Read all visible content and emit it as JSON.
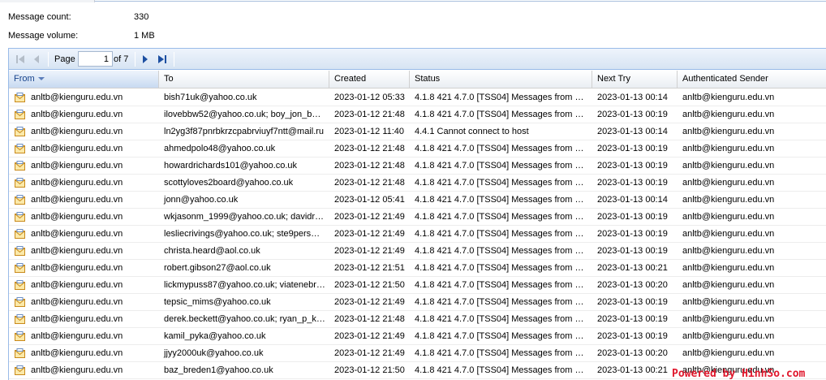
{
  "summary": {
    "message_count_label": "Message count:",
    "message_count_value": "330",
    "message_volume_label": "Message volume:",
    "message_volume_value": "1 MB"
  },
  "pager": {
    "page_label": "Page",
    "current_page": "1",
    "of_label": "of 7",
    "icons": [
      "first-page-icon",
      "previous-page-icon",
      "next-page-icon",
      "last-page-icon"
    ]
  },
  "columns": {
    "from": "From",
    "to": "To",
    "created": "Created",
    "status": "Status",
    "next_try": "Next Try",
    "auth_sender": "Authenticated Sender",
    "sorted_column": "from",
    "sort_direction": "descending"
  },
  "rows": [
    {
      "from": "anltb@kienguru.edu.vn",
      "to": "bish71uk@yahoo.co.uk",
      "created": "2023-01-12 05:33",
      "status": "4.1.8 421 4.7.0 [TSS04] Messages from …",
      "next_try": "2023-01-13 00:14",
      "auth": "anltb@kienguru.edu.vn"
    },
    {
      "from": "anltb@kienguru.edu.vn",
      "to": "ilovebbw52@yahoo.co.uk; boy_jon_b…",
      "created": "2023-01-12 21:48",
      "status": "4.1.8 421 4.7.0 [TSS04] Messages from …",
      "next_try": "2023-01-13 00:19",
      "auth": "anltb@kienguru.edu.vn"
    },
    {
      "from": "anltb@kienguru.edu.vn",
      "to": "ln2yg3f87pnrbkrzcpabrviuyf7ntt@mail.ru",
      "created": "2023-01-12 11:40",
      "status": "4.4.1 Cannot connect to host",
      "next_try": "2023-01-13 00:14",
      "auth": "anltb@kienguru.edu.vn"
    },
    {
      "from": "anltb@kienguru.edu.vn",
      "to": "ahmedpolo48@yahoo.co.uk",
      "created": "2023-01-12 21:48",
      "status": "4.1.8 421 4.7.0 [TSS04] Messages from …",
      "next_try": "2023-01-13 00:19",
      "auth": "anltb@kienguru.edu.vn"
    },
    {
      "from": "anltb@kienguru.edu.vn",
      "to": "howardrichards101@yahoo.co.uk",
      "created": "2023-01-12 21:48",
      "status": "4.1.8 421 4.7.0 [TSS04] Messages from …",
      "next_try": "2023-01-13 00:19",
      "auth": "anltb@kienguru.edu.vn"
    },
    {
      "from": "anltb@kienguru.edu.vn",
      "to": "scottyloves2board@yahoo.co.uk",
      "created": "2023-01-12 21:48",
      "status": "4.1.8 421 4.7.0 [TSS04] Messages from …",
      "next_try": "2023-01-13 00:19",
      "auth": "anltb@kienguru.edu.vn"
    },
    {
      "from": "anltb@kienguru.edu.vn",
      "to": "jonn@yahoo.co.uk",
      "created": "2023-01-12 05:41",
      "status": "4.1.8 421 4.7.0 [TSS04] Messages from …",
      "next_try": "2023-01-13 00:14",
      "auth": "anltb@kienguru.edu.vn"
    },
    {
      "from": "anltb@kienguru.edu.vn",
      "to": "wkjasonm_1999@yahoo.co.uk; davidr…",
      "created": "2023-01-12 21:49",
      "status": "4.1.8 421 4.7.0 [TSS04] Messages from …",
      "next_try": "2023-01-13 00:19",
      "auth": "anltb@kienguru.edu.vn"
    },
    {
      "from": "anltb@kienguru.edu.vn",
      "to": "lesliecrivings@yahoo.co.uk; ste9pers…",
      "created": "2023-01-12 21:49",
      "status": "4.1.8 421 4.7.0 [TSS04] Messages from …",
      "next_try": "2023-01-13 00:19",
      "auth": "anltb@kienguru.edu.vn"
    },
    {
      "from": "anltb@kienguru.edu.vn",
      "to": "christa.heard@aol.co.uk",
      "created": "2023-01-12 21:49",
      "status": "4.1.8 421 4.7.0 [TSS04] Messages from …",
      "next_try": "2023-01-13 00:19",
      "auth": "anltb@kienguru.edu.vn"
    },
    {
      "from": "anltb@kienguru.edu.vn",
      "to": "robert.gibson27@aol.co.uk",
      "created": "2023-01-12 21:51",
      "status": "4.1.8 421 4.7.0 [TSS04] Messages from …",
      "next_try": "2023-01-13 00:21",
      "auth": "anltb@kienguru.edu.vn"
    },
    {
      "from": "anltb@kienguru.edu.vn",
      "to": "lickmypuss87@yahoo.co.uk; viatenebr…",
      "created": "2023-01-12 21:50",
      "status": "4.1.8 421 4.7.0 [TSS04] Messages from …",
      "next_try": "2023-01-13 00:20",
      "auth": "anltb@kienguru.edu.vn"
    },
    {
      "from": "anltb@kienguru.edu.vn",
      "to": "tepsic_mims@yahoo.co.uk",
      "created": "2023-01-12 21:49",
      "status": "4.1.8 421 4.7.0 [TSS04] Messages from …",
      "next_try": "2023-01-13 00:19",
      "auth": "anltb@kienguru.edu.vn"
    },
    {
      "from": "anltb@kienguru.edu.vn",
      "to": "derek.beckett@yahoo.co.uk; ryan_p_k…",
      "created": "2023-01-12 21:48",
      "status": "4.1.8 421 4.7.0 [TSS04] Messages from …",
      "next_try": "2023-01-13 00:19",
      "auth": "anltb@kienguru.edu.vn"
    },
    {
      "from": "anltb@kienguru.edu.vn",
      "to": "kamil_pyka@yahoo.co.uk",
      "created": "2023-01-12 21:49",
      "status": "4.1.8 421 4.7.0 [TSS04] Messages from …",
      "next_try": "2023-01-13 00:19",
      "auth": "anltb@kienguru.edu.vn"
    },
    {
      "from": "anltb@kienguru.edu.vn",
      "to": "jjyy2000uk@yahoo.co.uk",
      "created": "2023-01-12 21:49",
      "status": "4.1.8 421 4.7.0 [TSS04] Messages from …",
      "next_try": "2023-01-13 00:20",
      "auth": "anltb@kienguru.edu.vn"
    },
    {
      "from": "anltb@kienguru.edu.vn",
      "to": "baz_breden1@yahoo.co.uk",
      "created": "2023-01-12 21:50",
      "status": "4.1.8 421 4.7.0 [TSS04] Messages from …",
      "next_try": "2023-01-13 00:21",
      "auth": "anltb@kienguru.edu.vn"
    }
  ],
  "row_icon": "mail-icon",
  "watermark": "Powered by HinhSo.com",
  "colors": {
    "grid_border": "#99bbe8",
    "toolbar_bg": "#dbe6f4",
    "pager_icon": "#1c4fa1",
    "watermark": "#e0182d"
  }
}
